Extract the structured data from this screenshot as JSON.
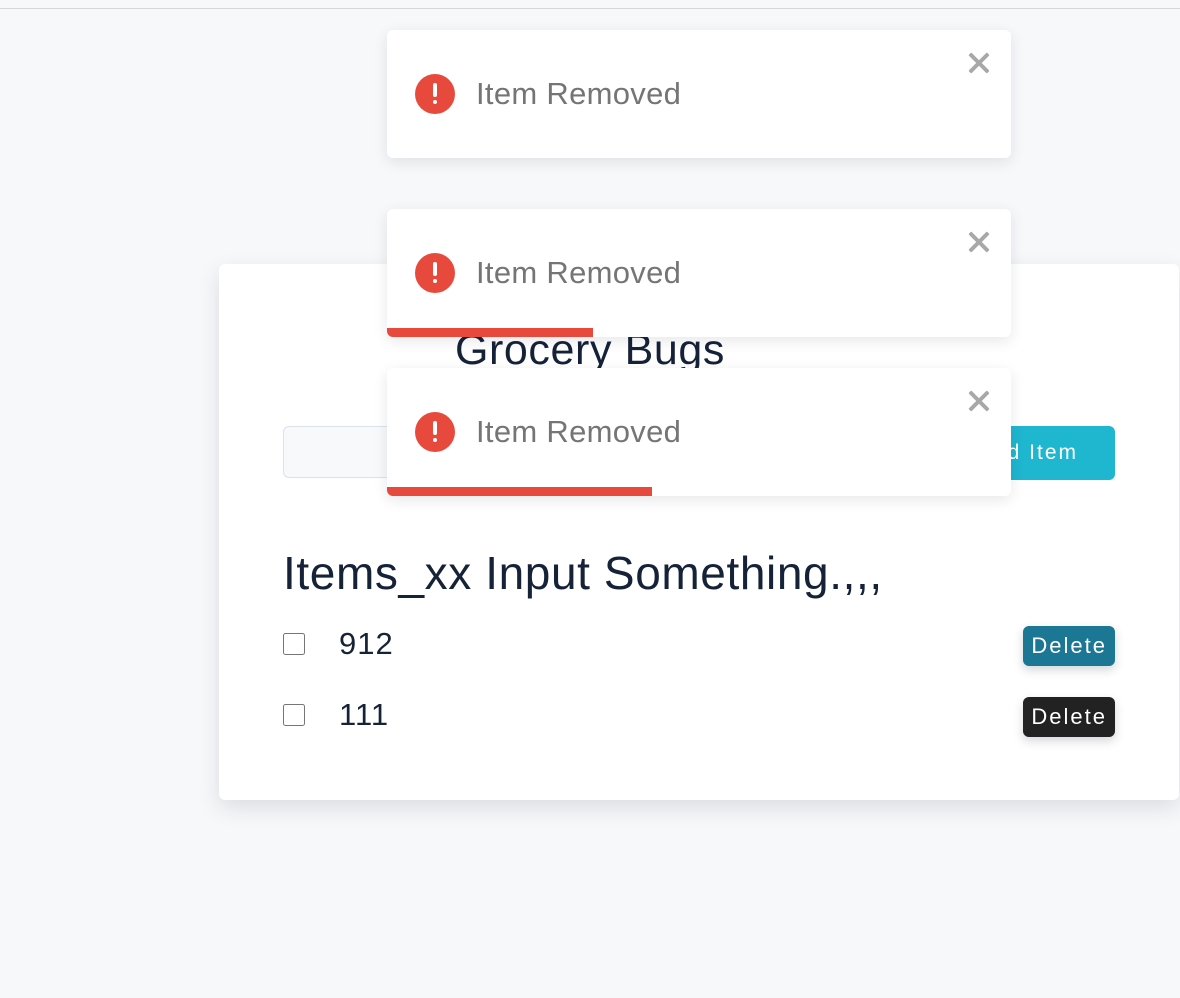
{
  "app": {
    "title": "Grocery Bugs"
  },
  "form": {
    "input_value": "",
    "input_placeholder": "",
    "add_button_label": "Add Item"
  },
  "items_heading": "Items_xx Input Something.,,,",
  "items": [
    {
      "name": "912",
      "checked": false,
      "delete_label": "Delete",
      "delete_color": "#1c7795"
    },
    {
      "name": "111",
      "checked": false,
      "delete_label": "Delete",
      "delete_color": "#222222"
    }
  ],
  "toasts": [
    {
      "icon": "error-icon",
      "message": "Item Removed",
      "close_icon": "close-icon",
      "progress": 0
    },
    {
      "icon": "error-icon",
      "message": "Item Removed",
      "close_icon": "close-icon",
      "progress": 0.33
    },
    {
      "icon": "error-icon",
      "message": "Item Removed",
      "close_icon": "close-icon",
      "progress": 0.425
    }
  ],
  "colors": {
    "background": "#f7f8fa",
    "card": "#ffffff",
    "accent": "#1fb6d0",
    "error": "#e7493c",
    "text": "#152238",
    "toast_text": "#757575"
  }
}
